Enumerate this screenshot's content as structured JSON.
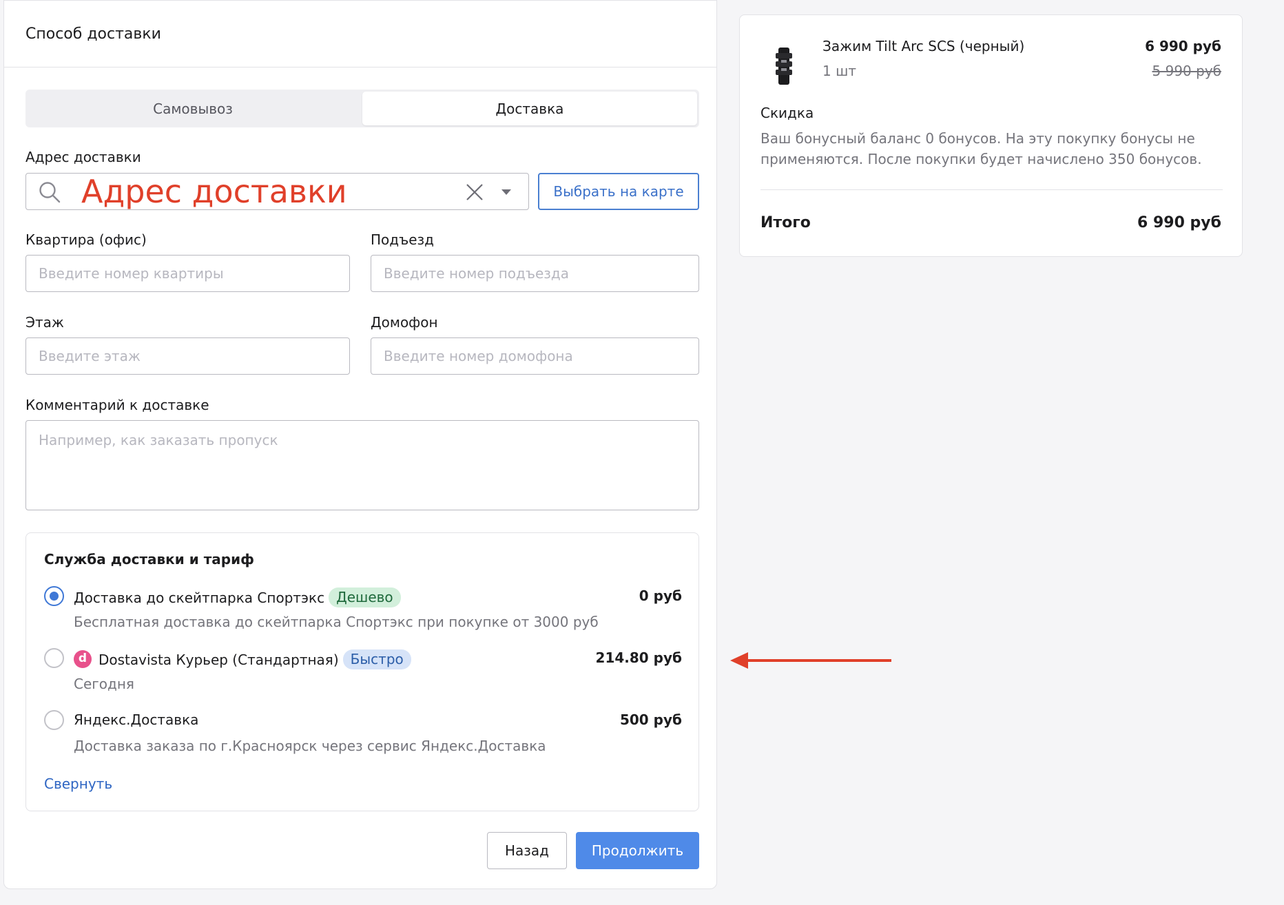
{
  "left": {
    "title": "Способ доставки",
    "tabs": [
      {
        "label": "Самовывоз",
        "active": false
      },
      {
        "label": "Доставка",
        "active": true
      }
    ],
    "address": {
      "label": "Адрес доставки",
      "placeholder": "Адрес доставки",
      "map_button": "Выбрать на карте"
    },
    "apartment": {
      "label": "Квартира (офис)",
      "placeholder": "Введите номер квартиры"
    },
    "entrance": {
      "label": "Подъезд",
      "placeholder": "Введите номер подъезда"
    },
    "floor": {
      "label": "Этаж",
      "placeholder": "Введите этаж"
    },
    "intercom": {
      "label": "Домофон",
      "placeholder": "Введите номер домофона"
    },
    "comment": {
      "label": "Комментарий к доставке",
      "placeholder": "Например, как заказать пропуск"
    },
    "service": {
      "title": "Служба доставки и тариф",
      "options": [
        {
          "name": "Доставка до скейтпарка Спортэкс",
          "badge": "Дешево",
          "price": "0 руб",
          "sub": "Бесплатная доставка до скейтпарка Спортэкс при покупке от 3000 руб",
          "selected": true
        },
        {
          "name": "Dostavista Курьер (Стандартная)",
          "badge": "Быстро",
          "price": "214.80 руб",
          "sub": "Сегодня",
          "logo": "d",
          "selected": false
        },
        {
          "name": "Яндекс.Доставка",
          "price": "500 руб",
          "sub": "Доставка заказа по г.Красноярск через сервис Яндекс.Доставка",
          "selected": false
        }
      ],
      "collapse": "Свернуть"
    },
    "buttons": {
      "back": "Назад",
      "next": "Продолжить"
    }
  },
  "summary": {
    "product": {
      "name": "Зажим Tilt Arc SCS (черный)",
      "qty": "1 шт",
      "price": "6 990 руб",
      "old_price": "5 990 руб"
    },
    "discount": {
      "title": "Скидка",
      "text": "Ваш бонусный баланс 0 бонусов. На эту покупку бонусы не применяются. После покупки будет начислено 350 бонусов."
    },
    "total": {
      "label": "Итого",
      "value": "6 990 руб"
    }
  },
  "colors": {
    "accent": "#4f8ae8",
    "annotation": "#e0402a"
  }
}
